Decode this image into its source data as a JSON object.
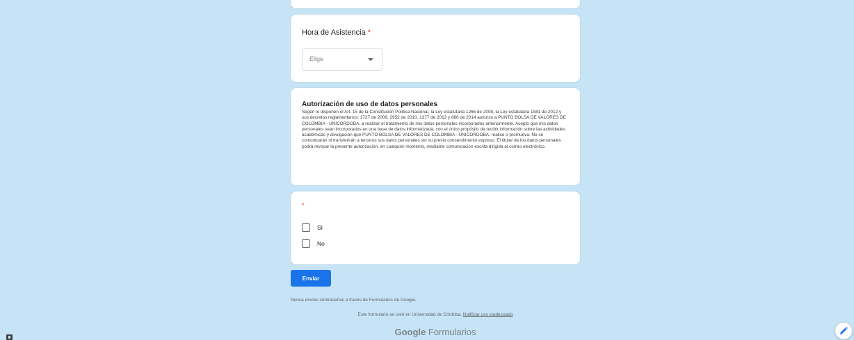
{
  "time_question": {
    "title": "Hora de Asistencia",
    "required_marker": "*",
    "dropdown_placeholder": "Elige"
  },
  "authorization": {
    "title": "Autorización de uso de datos personales",
    "text": "Según lo disponen el Art. 15 de la Constitución Política Nacional, la Ley estatutaria 1266 de 2008, la Ley estatutaria 1581 de 2012 y sus decretos reglamentarios: 1727 de 2009, 2952 de 2010, 1377 de 2013 y 886 de 2014 autorizo a PUNTO BOLSA DE VALORES DE COLOMBIA - UNICORDOBA. a realizar el tratamiento de mis datos personales incorporados anteriormente. Acepto que mis datos personales sean incorporados en una base de datos informatizada, con el único propósito de recibir información sobre las actividades académicas y divulgación que PUNTO BOLSA DE VALORES DE COLOMBIA - UNICORDOBA. realice o promueva. No se comunicarán ni transferirán a terceros sus datos personales sin su previo consentimiento expreso. El titular de los datos personales podrá revocar la presente autorización, en cualquier momento, mediante comunicación escrita dirigida al correo electrónico."
  },
  "consent_question": {
    "required_marker": "*",
    "options": [
      {
        "label": "SI",
        "checked": false
      },
      {
        "label": "No",
        "checked": false
      }
    ]
  },
  "submit_label": "Enviar",
  "footer": {
    "password_warning": "Nunca envíes contraseñas a través de Formularios de Google.",
    "created_text": "Este formulario se creó en Universidad de Córdoba.",
    "report_link": "Notificar uso inadecuado",
    "brand_google": "Google",
    "brand_forms": "Formularios"
  },
  "colors": {
    "background": "#c6e4f6",
    "accent": "#1a73e8",
    "required": "#d93025"
  },
  "icons": {
    "dropdown": "caret-down-icon",
    "edit": "pencil-icon"
  }
}
